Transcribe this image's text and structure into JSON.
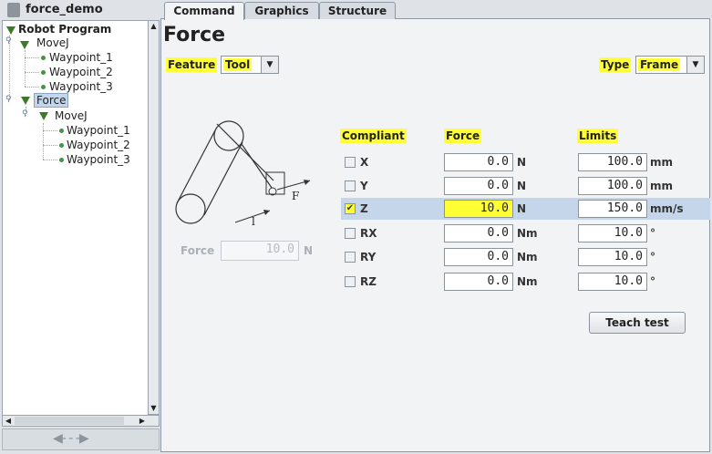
{
  "app": {
    "title": "force_demo"
  },
  "tree": {
    "root": "Robot Program",
    "movej1": "MoveJ",
    "wp1": "Waypoint_1",
    "wp2": "Waypoint_2",
    "wp3": "Waypoint_3",
    "force": "Force",
    "movej2": "MoveJ",
    "wp4": "Waypoint_1",
    "wp5": "Waypoint_2",
    "wp6": "Waypoint_3"
  },
  "tabs": [
    "Command",
    "Graphics",
    "Structure"
  ],
  "page": {
    "title": "Force",
    "feature_label": "Feature",
    "feature_value": "Tool",
    "type_label": "Type",
    "type_value": "Frame"
  },
  "columns": {
    "compliant": "Compliant",
    "force": "Force",
    "limits": "Limits"
  },
  "rows": [
    {
      "axis": "X",
      "force": "0.0",
      "force_unit": "N",
      "limit": "100.0",
      "limit_unit": "mm",
      "checked": false
    },
    {
      "axis": "Y",
      "force": "0.0",
      "force_unit": "N",
      "limit": "100.0",
      "limit_unit": "mm",
      "checked": false
    },
    {
      "axis": "Z",
      "force": "10.0",
      "force_unit": "N",
      "limit": "150.0",
      "limit_unit": "mm/s",
      "checked": true
    },
    {
      "axis": "RX",
      "force": "0.0",
      "force_unit": "Nm",
      "limit": "10.0",
      "limit_unit": "°",
      "checked": false
    },
    {
      "axis": "RY",
      "force": "0.0",
      "force_unit": "Nm",
      "limit": "10.0",
      "limit_unit": "°",
      "checked": false
    },
    {
      "axis": "RZ",
      "force": "0.0",
      "force_unit": "Nm",
      "limit": "10.0",
      "limit_unit": "°",
      "checked": false
    }
  ],
  "illustration": {
    "force_letter": "F",
    "length_letter": "l"
  },
  "force_input": {
    "label": "Force",
    "value": "10.0",
    "unit": "N"
  },
  "teach_button": "Teach test",
  "colors": {
    "highlight": "#ffff33",
    "selection": "#c5d6ea",
    "tree_green": "#3c7a2a"
  }
}
